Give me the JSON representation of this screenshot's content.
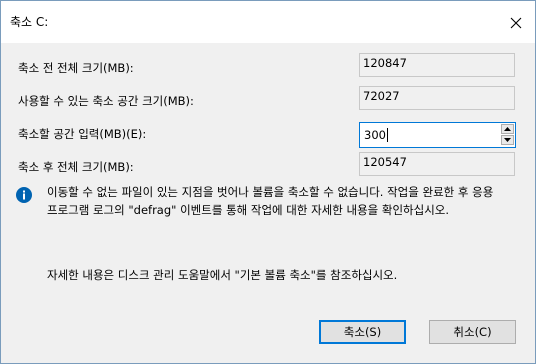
{
  "window": {
    "title": "축소 C:",
    "close_icon": "close-icon"
  },
  "fields": {
    "total_before_label": "축소 전 전체 크기(MB):",
    "total_before_value": "120847",
    "available_label": "사용할 수 있는 축소 공간 크기(MB):",
    "available_value": "72027",
    "shrink_amount_label": "축소할 공간 입력(MB)(E):",
    "shrink_amount_value": "300",
    "total_after_label": "축소 후 전체 크기(MB):",
    "total_after_value": "120547"
  },
  "info": {
    "icon": "info-icon",
    "icon_color": "#0063b1",
    "message": "이동할 수 없는 파일이 있는 지점을 벗어나 볼륨을 축소할 수 없습니다. 작업을 완료한 후 응용 프로그램 로그의 \"defrag\" 이벤트를 통해 작업에 대한 자세한 내용을 확인하십시오.",
    "help": "자세한 내용은 디스크 관리 도움말에서 \"기본 볼륨 축소\"를 참조하십시오."
  },
  "buttons": {
    "shrink_label": "축소(S)",
    "cancel_label": "취소(C)"
  }
}
